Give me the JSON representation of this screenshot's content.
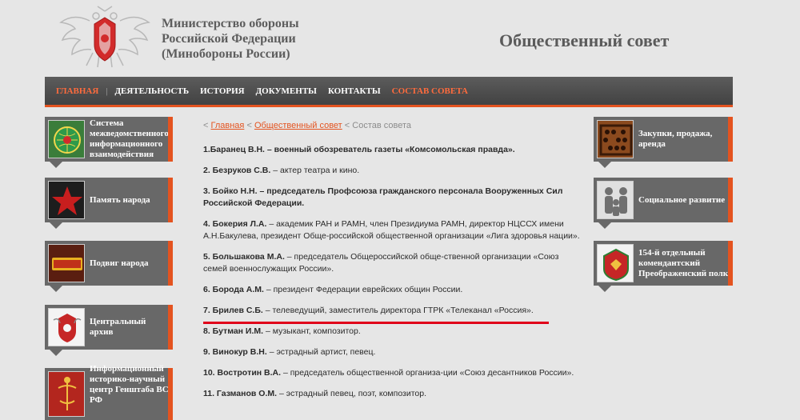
{
  "header": {
    "ministry_line1": "Министерство обороны",
    "ministry_line2": "Российской Федерации",
    "ministry_line3": "(Минобороны России)",
    "site_title": "Общественный совет"
  },
  "nav": {
    "items": [
      {
        "label": "ГЛАВНАЯ"
      },
      {
        "label": "ДЕЯТЕЛЬНОСТЬ"
      },
      {
        "label": "ИСТОРИЯ"
      },
      {
        "label": "ДОКУМЕНТЫ"
      },
      {
        "label": "КОНТАКТЫ"
      },
      {
        "label": "СОСТАВ СОВЕТА"
      }
    ]
  },
  "left_sidebar": {
    "items": [
      {
        "label": "Система межведомственного информационного взаимодействия",
        "icon": "globe-emblem-icon"
      },
      {
        "label": "Память народа",
        "icon": "red-star-icon"
      },
      {
        "label": "Подвиг народа",
        "icon": "podvig-naroda-logo-icon"
      },
      {
        "label": "Центральный архив",
        "icon": "archive-emblem-icon"
      },
      {
        "label": "Информационный историко-научный центр Генштаба ВС РФ",
        "icon": "general-staff-emblem-icon"
      }
    ]
  },
  "right_sidebar": {
    "items": [
      {
        "label": "Закупки, продажа, аренда",
        "icon": "abacus-icon"
      },
      {
        "label": "Социальное развитие",
        "icon": "family-icon"
      },
      {
        "label": "154-й отдельный комендантский Преображенский полк",
        "icon": "regiment-emblem-icon"
      }
    ]
  },
  "breadcrumb": {
    "link1": "Главная",
    "link2": "Общественный совет",
    "current": "Состав совета",
    "separator": "<"
  },
  "members": [
    {
      "name": "1.Баранец В.Н.",
      "desc": "– военный обозреватель газеты «Комсомольская правда».",
      "desc_bold": true
    },
    {
      "name": "2. Безруков С.В.",
      "desc": "– актер театра и кино.",
      "desc_bold": false
    },
    {
      "name": "3. Бойко Н.Н.",
      "desc": "– председатель Профсоюза гражданского персонала Вооруженных Сил Российской Федерации.",
      "desc_bold": true
    },
    {
      "name": "4. Бокерия Л.А.",
      "desc": "– академик РАН и РАМН, член Президиума РАМН, директор НЦССХ имени А.Н.Бакулева, президент Обще-российской общественной организации «Лига здоровья нации».",
      "desc_bold": false
    },
    {
      "name": "5. Большакова М.А.",
      "desc": "– председатель Общероссийской обще-ственной организации «Союз семей военнослужащих России».",
      "desc_bold": false
    },
    {
      "name": "6. Борода А.М.",
      "desc": "– президент Федерации еврейских общин России.",
      "desc_bold": false
    },
    {
      "name": "7. Брилев С.Б.",
      "desc": "– телеведущий, заместитель директора ГТРК «Телеканал «Россия».",
      "desc_bold": false
    },
    {
      "name": "8. Бутман И.М.",
      "desc": "– музыкант, композитор.",
      "desc_bold": false
    },
    {
      "name": "9. Винокур В.Н.",
      "desc": "– эстрадный артист, певец.",
      "desc_bold": false
    },
    {
      "name": "10. Вострoтин В.А.",
      "desc": "– председатель общественной организа-ции «Союз десантников России».",
      "desc_bold": false
    },
    {
      "name": "11. Газманов О.М.",
      "desc": "– эстрадный певец, поэт, композитор.",
      "desc_bold": false
    }
  ],
  "colors": {
    "accent": "#e4531f",
    "highlight_underline": "#e0001a",
    "nav_bg": "#4a4a4a",
    "sidebox_bg": "#686868",
    "page_bg": "#e6e6e6"
  }
}
